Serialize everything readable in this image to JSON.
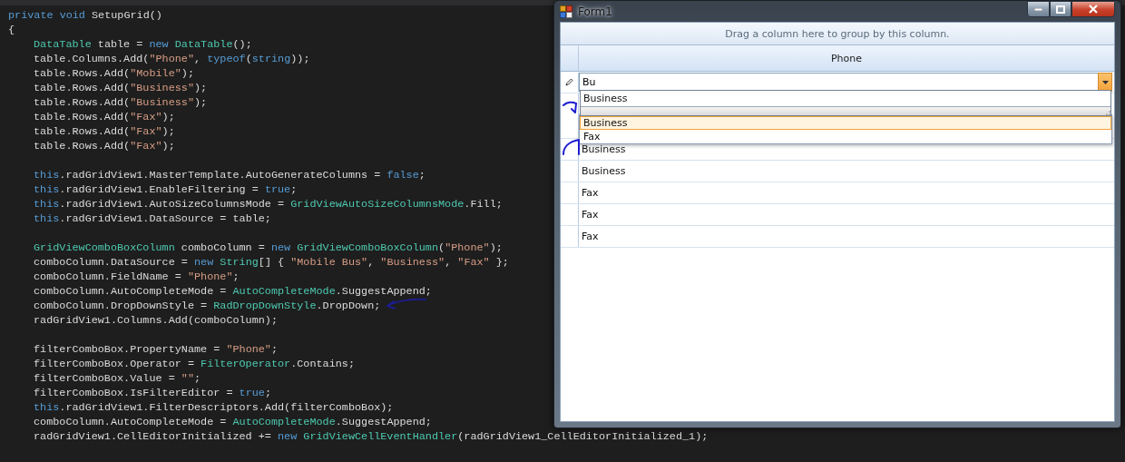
{
  "editor": {
    "signature": [
      {
        "kind": "keyword",
        "text": "private void"
      },
      {
        "kind": "plain",
        "text": " SetupGrid()"
      }
    ],
    "open_brace": "{",
    "blocks": [
      [
        [
          {
            "kind": "type",
            "text": "DataTable"
          },
          {
            "kind": "plain",
            "text": " table = "
          },
          {
            "kind": "keyword",
            "text": "new "
          },
          {
            "kind": "type",
            "text": "DataTable"
          },
          {
            "kind": "plain",
            "text": "();"
          }
        ],
        [
          {
            "kind": "plain",
            "text": "table.Columns.Add("
          },
          {
            "kind": "string",
            "text": "\"Phone\""
          },
          {
            "kind": "plain",
            "text": ", "
          },
          {
            "kind": "keyword",
            "text": "typeof"
          },
          {
            "kind": "plain",
            "text": "("
          },
          {
            "kind": "keyword",
            "text": "string"
          },
          {
            "kind": "plain",
            "text": "));"
          }
        ],
        [
          {
            "kind": "plain",
            "text": "table.Rows.Add("
          },
          {
            "kind": "string",
            "text": "\"Mobile\""
          },
          {
            "kind": "plain",
            "text": ");"
          }
        ],
        [
          {
            "kind": "plain",
            "text": "table.Rows.Add("
          },
          {
            "kind": "string",
            "text": "\"Business\""
          },
          {
            "kind": "plain",
            "text": ");"
          }
        ],
        [
          {
            "kind": "plain",
            "text": "table.Rows.Add("
          },
          {
            "kind": "string",
            "text": "\"Business\""
          },
          {
            "kind": "plain",
            "text": ");"
          }
        ],
        [
          {
            "kind": "plain",
            "text": "table.Rows.Add("
          },
          {
            "kind": "string",
            "text": "\"Fax\""
          },
          {
            "kind": "plain",
            "text": ");"
          }
        ],
        [
          {
            "kind": "plain",
            "text": "table.Rows.Add("
          },
          {
            "kind": "string",
            "text": "\"Fax\""
          },
          {
            "kind": "plain",
            "text": ");"
          }
        ],
        [
          {
            "kind": "plain",
            "text": "table.Rows.Add("
          },
          {
            "kind": "string",
            "text": "\"Fax\""
          },
          {
            "kind": "plain",
            "text": ");"
          }
        ]
      ],
      [
        [
          {
            "kind": "keyword",
            "text": "this"
          },
          {
            "kind": "plain",
            "text": ".radGridView1.MasterTemplate.AutoGenerateColumns = "
          },
          {
            "kind": "keyword",
            "text": "false"
          },
          {
            "kind": "plain",
            "text": ";"
          }
        ],
        [
          {
            "kind": "keyword",
            "text": "this"
          },
          {
            "kind": "plain",
            "text": ".radGridView1.EnableFiltering = "
          },
          {
            "kind": "keyword",
            "text": "true"
          },
          {
            "kind": "plain",
            "text": ";"
          }
        ],
        [
          {
            "kind": "keyword",
            "text": "this"
          },
          {
            "kind": "plain",
            "text": ".radGridView1.AutoSizeColumnsMode = "
          },
          {
            "kind": "type",
            "text": "GridViewAutoSizeColumnsMode"
          },
          {
            "kind": "plain",
            "text": ".Fill;"
          }
        ],
        [
          {
            "kind": "keyword",
            "text": "this"
          },
          {
            "kind": "plain",
            "text": ".radGridView1.DataSource = table;"
          }
        ]
      ],
      [
        [
          {
            "kind": "type",
            "text": "GridViewComboBoxColumn"
          },
          {
            "kind": "plain",
            "text": " comboColumn = "
          },
          {
            "kind": "keyword",
            "text": "new "
          },
          {
            "kind": "type",
            "text": "GridViewComboBoxColumn"
          },
          {
            "kind": "plain",
            "text": "("
          },
          {
            "kind": "string",
            "text": "\"Phone\""
          },
          {
            "kind": "plain",
            "text": ");"
          }
        ],
        [
          {
            "kind": "plain",
            "text": "comboColumn.DataSource = "
          },
          {
            "kind": "keyword",
            "text": "new "
          },
          {
            "kind": "type",
            "text": "String"
          },
          {
            "kind": "plain",
            "text": "[] { "
          },
          {
            "kind": "string",
            "text": "\"Mobile Bus\""
          },
          {
            "kind": "plain",
            "text": ", "
          },
          {
            "kind": "string",
            "text": "\"Business\""
          },
          {
            "kind": "plain",
            "text": ", "
          },
          {
            "kind": "string",
            "text": "\"Fax\""
          },
          {
            "kind": "plain",
            "text": " };"
          }
        ],
        [
          {
            "kind": "plain",
            "text": "comboColumn.FieldName = "
          },
          {
            "kind": "string",
            "text": "\"Phone\""
          },
          {
            "kind": "plain",
            "text": ";"
          }
        ],
        [
          {
            "kind": "plain",
            "text": "comboColumn.AutoCompleteMode = "
          },
          {
            "kind": "type",
            "text": "AutoCompleteMode"
          },
          {
            "kind": "plain",
            "text": ".SuggestAppend;"
          }
        ],
        [
          {
            "kind": "plain",
            "text": "comboColumn.DropDownStyle = "
          },
          {
            "kind": "type",
            "text": "RadDropDownStyle"
          },
          {
            "kind": "plain",
            "text": ".DropDown;"
          }
        ],
        [
          {
            "kind": "plain",
            "text": "radGridView1.Columns.Add(comboColumn);"
          }
        ]
      ],
      [
        [
          {
            "kind": "plain",
            "text": "filterComboBox.PropertyName = "
          },
          {
            "kind": "string",
            "text": "\"Phone\""
          },
          {
            "kind": "plain",
            "text": ";"
          }
        ],
        [
          {
            "kind": "plain",
            "text": "filterComboBox.Operator = "
          },
          {
            "kind": "type",
            "text": "FilterOperator"
          },
          {
            "kind": "plain",
            "text": ".Contains;"
          }
        ],
        [
          {
            "kind": "plain",
            "text": "filterComboBox.Value = "
          },
          {
            "kind": "string",
            "text": "\"\""
          },
          {
            "kind": "plain",
            "text": ";"
          }
        ],
        [
          {
            "kind": "plain",
            "text": "filterComboBox.IsFilterEditor = "
          },
          {
            "kind": "keyword",
            "text": "true"
          },
          {
            "kind": "plain",
            "text": ";"
          }
        ],
        [
          {
            "kind": "keyword",
            "text": "this"
          },
          {
            "kind": "plain",
            "text": ".radGridView1.FilterDescriptors.Add(filterComboBox);"
          }
        ],
        [
          {
            "kind": "plain",
            "text": "comboColumn.AutoCompleteMode = "
          },
          {
            "kind": "type",
            "text": "AutoCompleteMode"
          },
          {
            "kind": "plain",
            "text": ".SuggestAppend;"
          }
        ],
        [
          {
            "kind": "plain",
            "text": "radGridView1.CellEditorInitialized += "
          },
          {
            "kind": "keyword",
            "text": "new "
          },
          {
            "kind": "type",
            "text": "GridViewCellEventHandler"
          },
          {
            "kind": "plain",
            "text": "(radGridView1_CellEditorInitialized_1);"
          }
        ]
      ]
    ]
  },
  "window": {
    "title": "Form1",
    "grid": {
      "group_panel": "Drag a column here to group by this column.",
      "columns": [
        "Phone"
      ],
      "filter": {
        "value": "Bu",
        "suggestions": [
          "Business"
        ],
        "dropdown_items": [
          {
            "label": "Business",
            "selected": true
          },
          {
            "label": "Fax",
            "selected": false
          }
        ]
      },
      "rows": [
        "Business",
        "Business",
        "Fax",
        "Fax",
        "Fax"
      ]
    }
  }
}
